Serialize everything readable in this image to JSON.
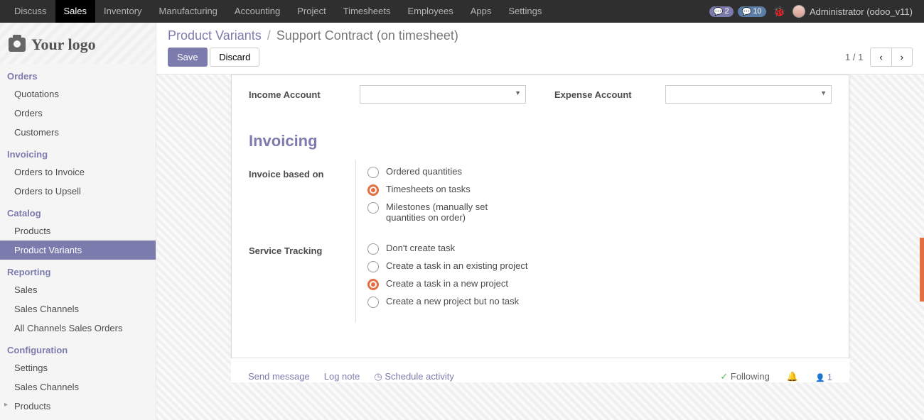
{
  "topnav": {
    "items": [
      "Discuss",
      "Sales",
      "Inventory",
      "Manufacturing",
      "Accounting",
      "Project",
      "Timesheets",
      "Employees",
      "Apps",
      "Settings"
    ],
    "active": "Sales",
    "badge1": "2",
    "badge2": "10",
    "user": "Administrator (odoo_v11)"
  },
  "logo": {
    "text": "Your logo"
  },
  "sidebar": {
    "sections": [
      {
        "title": "Orders",
        "items": [
          "Quotations",
          "Orders",
          "Customers"
        ]
      },
      {
        "title": "Invoicing",
        "items": [
          "Orders to Invoice",
          "Orders to Upsell"
        ]
      },
      {
        "title": "Catalog",
        "items": [
          "Products",
          "Product Variants"
        ],
        "active": "Product Variants"
      },
      {
        "title": "Reporting",
        "items": [
          "Sales",
          "Sales Channels",
          "All Channels Sales Orders"
        ]
      },
      {
        "title": "Configuration",
        "items": [
          "Settings",
          "Sales Channels",
          "Products"
        ],
        "caret": [
          "Products"
        ]
      }
    ]
  },
  "breadcrumb": {
    "link": "Product Variants",
    "current": "Support Contract (on timesheet)"
  },
  "buttons": {
    "save": "Save",
    "discard": "Discard"
  },
  "pager": {
    "text": "1 / 1"
  },
  "form": {
    "income_label": "Income Account",
    "expense_label": "Expense Account",
    "section_invoicing": "Invoicing",
    "invoice_based_label": "Invoice based on",
    "invoice_opts": [
      "Ordered quantities",
      "Timesheets on tasks",
      "Milestones (manually set quantities on order)"
    ],
    "invoice_selected": 1,
    "service_tracking_label": "Service Tracking",
    "service_opts": [
      "Don't create task",
      "Create a task in an existing project",
      "Create a task in a new project",
      "Create a new project but no task"
    ],
    "service_selected": 2
  },
  "chatter": {
    "send": "Send message",
    "log": "Log note",
    "schedule": "Schedule activity",
    "following": "Following",
    "followers": "1"
  }
}
